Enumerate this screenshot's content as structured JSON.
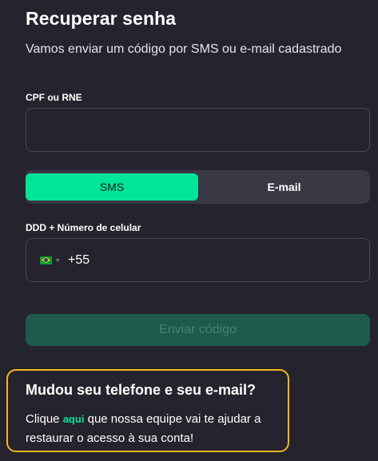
{
  "page": {
    "title": "Recuperar senha",
    "subtitle": "Vamos enviar um código por SMS ou e-mail cadastrado"
  },
  "cpf": {
    "label": "CPF ou RNE",
    "value": ""
  },
  "method_toggle": {
    "options": [
      "SMS",
      "E-mail"
    ],
    "selected": "SMS"
  },
  "phone": {
    "label": "DDD + Número de celular",
    "country_flag": "brazil-flag-icon",
    "dial_code": "+55"
  },
  "submit": {
    "label": "Enviar código",
    "enabled": false
  },
  "help": {
    "title": "Mudou seu telefone e seu e-mail?",
    "text_before": "Clique ",
    "link": "aqui",
    "text_after": " que nossa equipe vai te ajudar a restaurar o acesso à sua conta!"
  },
  "colors": {
    "background": "#25232d",
    "accent": "#00e59a",
    "button_disabled": "#1e5a4c",
    "highlight_border": "#f4b820"
  }
}
